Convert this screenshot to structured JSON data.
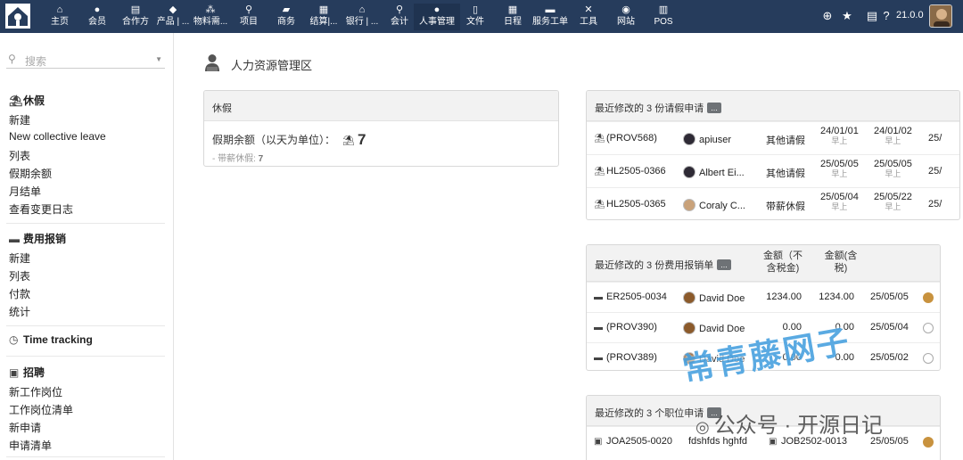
{
  "topbar": {
    "menu": [
      {
        "label": "主页",
        "icon": "home-icon",
        "glyph": "⌂"
      },
      {
        "label": "会员",
        "icon": "member-icon",
        "glyph": "●"
      },
      {
        "label": "合作方",
        "icon": "building-icon",
        "glyph": "▤"
      },
      {
        "label": "产品 | ...",
        "icon": "cube-icon",
        "glyph": "◆"
      },
      {
        "label": "物料需...",
        "icon": "cubes-icon",
        "glyph": "⁂"
      },
      {
        "label": "项目",
        "icon": "sitemap-icon",
        "glyph": "⚲"
      },
      {
        "label": "商务",
        "icon": "suitcase-icon",
        "glyph": "▰"
      },
      {
        "label": "结算|...",
        "icon": "invoice-icon",
        "glyph": "▦"
      },
      {
        "label": "银行 | ...",
        "icon": "bank-icon",
        "glyph": "⌂"
      },
      {
        "label": "会计",
        "icon": "search-dollar-icon",
        "glyph": "⚲"
      },
      {
        "label": "人事管理",
        "icon": "user-icon",
        "glyph": "●"
      },
      {
        "label": "文件",
        "icon": "file-icon",
        "glyph": "▯"
      },
      {
        "label": "日程",
        "icon": "calendar-icon",
        "glyph": "▦"
      },
      {
        "label": "服务工单",
        "icon": "ticket-icon",
        "glyph": "▬"
      },
      {
        "label": "工具",
        "icon": "tools-icon",
        "glyph": "✕"
      },
      {
        "label": "网站",
        "icon": "globe-icon",
        "glyph": "◉"
      },
      {
        "label": "POS",
        "icon": "cash-register-icon",
        "glyph": "▥"
      }
    ],
    "version": "21.0.0"
  },
  "sidebar": {
    "search_placeholder": "搜索",
    "sections": [
      {
        "title": "休假",
        "icon": "beach-umbrella-icon",
        "glyph": "⛱",
        "items": [
          "新建",
          "New collective leave",
          "列表",
          "假期余额",
          "月结单",
          "查看变更日志"
        ]
      },
      {
        "title": "费用报销",
        "icon": "wallet-icon",
        "glyph": "▬",
        "items": [
          "新建",
          "列表",
          "付款",
          "统计"
        ]
      },
      {
        "title": "Time tracking",
        "icon": "clock-icon",
        "glyph": "◷",
        "items": []
      },
      {
        "title": "招聘",
        "icon": "id-badge-icon",
        "glyph": "▣",
        "items": [
          "新工作岗位",
          "工作岗位清单",
          "新申请",
          "申请清单"
        ]
      }
    ]
  },
  "page": {
    "title": "人力资源管理区"
  },
  "leave_box": {
    "title": "休假",
    "balance_label": "假期余额（以天为单位）：",
    "balance_value": "7",
    "paid_label": "- 带薪休假:",
    "paid_value": "7"
  },
  "leave_requests": {
    "title": "最近修改的 3 份请假申请",
    "more": "...",
    "rows": [
      {
        "ref": "(PROV568)",
        "user": "apiuser",
        "type": "其他请假",
        "start": "24/01/01",
        "start_half": "早上",
        "end": "24/01/02",
        "end_half": "早上",
        "extra": "25/"
      },
      {
        "ref": "HL2505-0366",
        "user": "Albert Ei...",
        "type": "其他请假",
        "start": "25/05/05",
        "start_half": "早上",
        "end": "25/05/05",
        "end_half": "早上",
        "extra": "25/"
      },
      {
        "ref": "HL2505-0365",
        "user": "Coraly C...",
        "type": "带薪休假",
        "start": "25/05/04",
        "start_half": "早上",
        "end": "25/05/22",
        "end_half": "早上",
        "extra": "25/"
      }
    ]
  },
  "expense_reports": {
    "title": "最近修改的 3 份费用报销单",
    "more": "...",
    "col_ht_1": "金额（不",
    "col_ht_2": "含税金)",
    "col_ttc_1": "金额(含",
    "col_ttc_2": "税)",
    "rows": [
      {
        "ref": "ER2505-0034",
        "user": "David Doe",
        "amount_ht": "1234.00",
        "amount_ttc": "1234.00",
        "date": "25/05/05",
        "status": "done"
      },
      {
        "ref": "(PROV390)",
        "user": "David Doe",
        "amount_ht": "0.00",
        "amount_ttc": "0.00",
        "date": "25/05/04",
        "status": "draft"
      },
      {
        "ref": "(PROV389)",
        "user": "David Doe",
        "amount_ht": "0.00",
        "amount_ttc": "0.00",
        "date": "25/05/02",
        "status": "draft"
      }
    ]
  },
  "job_applications": {
    "title": "最近修改的 3 个职位申请",
    "more": "...",
    "rows": [
      {
        "ref": "JOA2505-0020",
        "name": "fdshfds hghfd",
        "job": "JOB2502-0013",
        "date": "25/05/05",
        "status": "done"
      }
    ]
  },
  "watermark": {
    "big": "常青藤网子",
    "small": "公众号 · 开源日记"
  },
  "colors": {
    "topbar": "#263c5c",
    "status_done": "#c8923e",
    "watermark_blue": "#4da3e0"
  }
}
